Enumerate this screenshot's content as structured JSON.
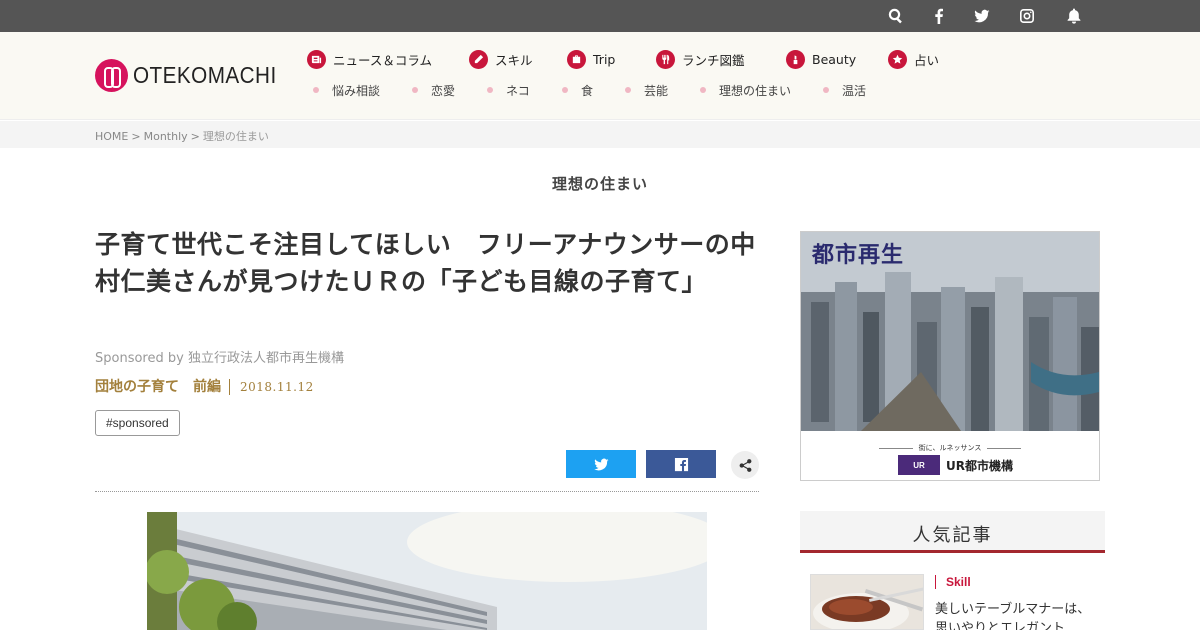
{
  "topbar": {
    "icons": [
      "search-icon",
      "facebook-icon",
      "twitter-icon",
      "instagram-icon",
      "bell-icon"
    ],
    "background": "#555555"
  },
  "header": {
    "logo_text": "OTEKOMACHI",
    "primary_nav": [
      {
        "label": "ニュース＆コラム",
        "icon": "newspaper-icon"
      },
      {
        "label": "スキル",
        "icon": "pencil-icon"
      },
      {
        "label": "Trip",
        "icon": "suitcase-icon"
      },
      {
        "label": "ランチ図鑑",
        "icon": "fork-knife-icon"
      },
      {
        "label": "Beauty",
        "icon": "lipstick-icon"
      },
      {
        "label": "占い",
        "icon": "star-icon"
      }
    ],
    "secondary_nav": [
      "悩み相談",
      "恋愛",
      "ネコ",
      "食",
      "芸能",
      "理想の住まい",
      "温活"
    ],
    "accent_color": "#c8163b",
    "logo_color": "#d6135d"
  },
  "breadcrumb": {
    "home": "HOME",
    "monthly": "Monthly",
    "current": "理想の住まい",
    "separator": ">"
  },
  "section": {
    "title": "理想の住まい"
  },
  "article": {
    "title": "子育て世代こそ注目してほしい　フリーアナウンサーの中村仁美さんが見つけたＵＲの「子ども目線の子育て」",
    "sponsor": "Sponsored by 独立行政法人都市再生機構",
    "series": "団地の子育て　前編",
    "date": "2018.11.12",
    "tag": "#sponsored",
    "meta_color": "#a3803c"
  },
  "share": {
    "twitter_color": "#1da1f2",
    "facebook_color": "#3b5998",
    "icons": [
      "twitter-icon",
      "facebook-icon",
      "share-icon"
    ]
  },
  "ad": {
    "headline": "都市再生",
    "tagline": "街に、ルネッサンス",
    "ur_mark": "UR",
    "brand": "UR都市機構"
  },
  "popular": {
    "title": "人気記事",
    "items": [
      {
        "category": "Skill",
        "text": "美しいテーブルマナーは、思いやりとエレガント"
      }
    ],
    "accent_color": "#a3282e"
  }
}
